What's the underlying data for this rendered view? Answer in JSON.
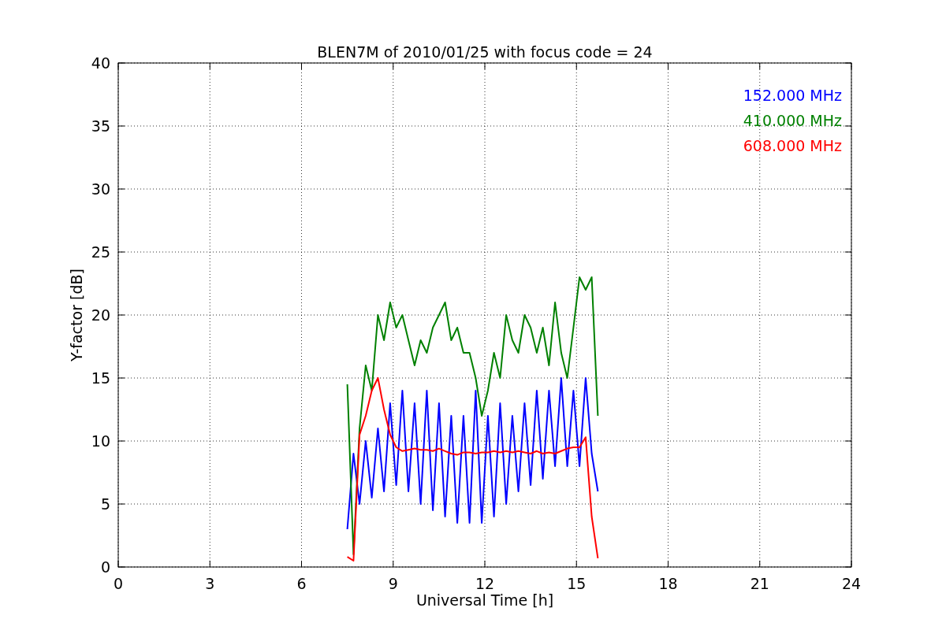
{
  "figure": {
    "chart_data": {
      "type": "line",
      "title": "BLEN7M of 2010/01/25 with focus code = 24",
      "xlabel": "Universal Time [h]",
      "ylabel": "Y-factor [dB]",
      "x": [
        7.5,
        7.7,
        7.9,
        8.1,
        8.3,
        8.5,
        8.7,
        8.9,
        9.1,
        9.3,
        9.5,
        9.7,
        9.9,
        10.1,
        10.3,
        10.5,
        10.7,
        10.9,
        11.1,
        11.3,
        11.5,
        11.7,
        11.9,
        12.1,
        12.3,
        12.5,
        12.7,
        12.9,
        13.1,
        13.3,
        13.5,
        13.7,
        13.9,
        14.1,
        14.3,
        14.5,
        14.7,
        14.9,
        15.1,
        15.3,
        15.5,
        15.7
      ],
      "series": [
        {
          "name": "152.000 MHz",
          "color": "#0000ff",
          "values": [
            3,
            9,
            5,
            10,
            5.5,
            11,
            6,
            13,
            6.5,
            14,
            6,
            13,
            5,
            14,
            4.5,
            13,
            4,
            12,
            3.5,
            12,
            3.5,
            14,
            3.5,
            12,
            4,
            13,
            5,
            12,
            6,
            13,
            6.5,
            14,
            7,
            14,
            8,
            15,
            8,
            14,
            8,
            15,
            9,
            6
          ]
        },
        {
          "name": "410.000 MHz",
          "color": "#008000",
          "values": [
            14.5,
            1,
            11,
            16,
            14,
            20,
            18,
            21,
            19,
            20,
            18,
            16,
            18,
            17,
            19,
            20,
            21,
            18,
            19,
            17,
            17,
            15,
            12,
            14,
            17,
            15,
            20,
            18,
            17,
            20,
            19,
            17,
            19,
            16,
            21,
            17,
            15,
            19,
            23,
            22,
            23,
            12
          ]
        },
        {
          "name": "608.000 MHz",
          "color": "#ff0000",
          "values": [
            0.8,
            0.5,
            10.5,
            12,
            14,
            15,
            12.5,
            10.5,
            9.5,
            9.2,
            9.3,
            9.4,
            9.3,
            9.3,
            9.2,
            9.4,
            9.2,
            9,
            8.9,
            9.1,
            9.1,
            9,
            9.1,
            9.1,
            9.2,
            9.1,
            9.2,
            9.1,
            9.2,
            9.1,
            9,
            9.2,
            9,
            9.1,
            9,
            9.2,
            9.4,
            9.5,
            9.5,
            10.3,
            4,
            0.7
          ]
        }
      ],
      "grid": true,
      "xlim": [
        0,
        24
      ],
      "ylim": [
        0,
        40
      ],
      "xticks": [
        0,
        3,
        6,
        9,
        12,
        15,
        18,
        21,
        24
      ],
      "yticks": [
        0,
        5,
        10,
        15,
        20,
        25,
        30,
        35,
        40
      ]
    }
  }
}
